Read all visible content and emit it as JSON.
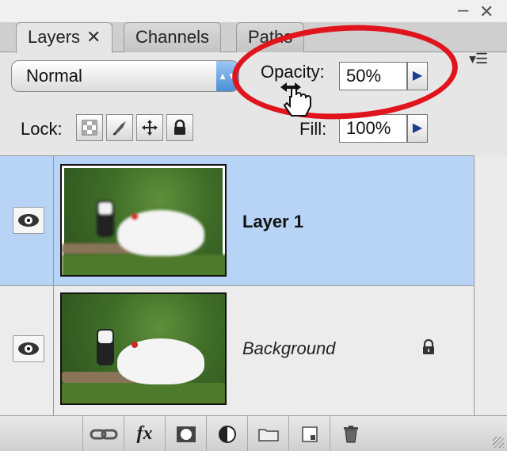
{
  "tabs": [
    {
      "label": "Layers",
      "close": "✕"
    },
    {
      "label": "Channels"
    },
    {
      "label": "Paths"
    }
  ],
  "window_controls": {
    "minimize": "–",
    "close": "✕"
  },
  "panel_menu": "▾☰",
  "blend_mode": {
    "value": "Normal"
  },
  "opacity": {
    "label": "Opacity:",
    "value": "50%"
  },
  "fill": {
    "label": "Fill:",
    "value": "100%"
  },
  "lock": {
    "label": "Lock:",
    "buttons": [
      "lock-transparent-pixels-icon",
      "lock-image-pixels-icon",
      "lock-position-icon",
      "lock-all-icon"
    ]
  },
  "layers": [
    {
      "name": "Layer 1",
      "selected": true,
      "visible": true,
      "locked": false
    },
    {
      "name": "Background",
      "selected": false,
      "visible": true,
      "locked": true
    }
  ],
  "bottom_toolbar": [
    "link-layers-icon",
    "fx-icon",
    "layer-mask-icon",
    "adjustment-layer-icon",
    "group-folder-icon",
    "new-layer-icon",
    "trash-icon"
  ],
  "fx_label": "fx",
  "annotation_color": "#e0141c",
  "selection_color": "#b7d3f5"
}
